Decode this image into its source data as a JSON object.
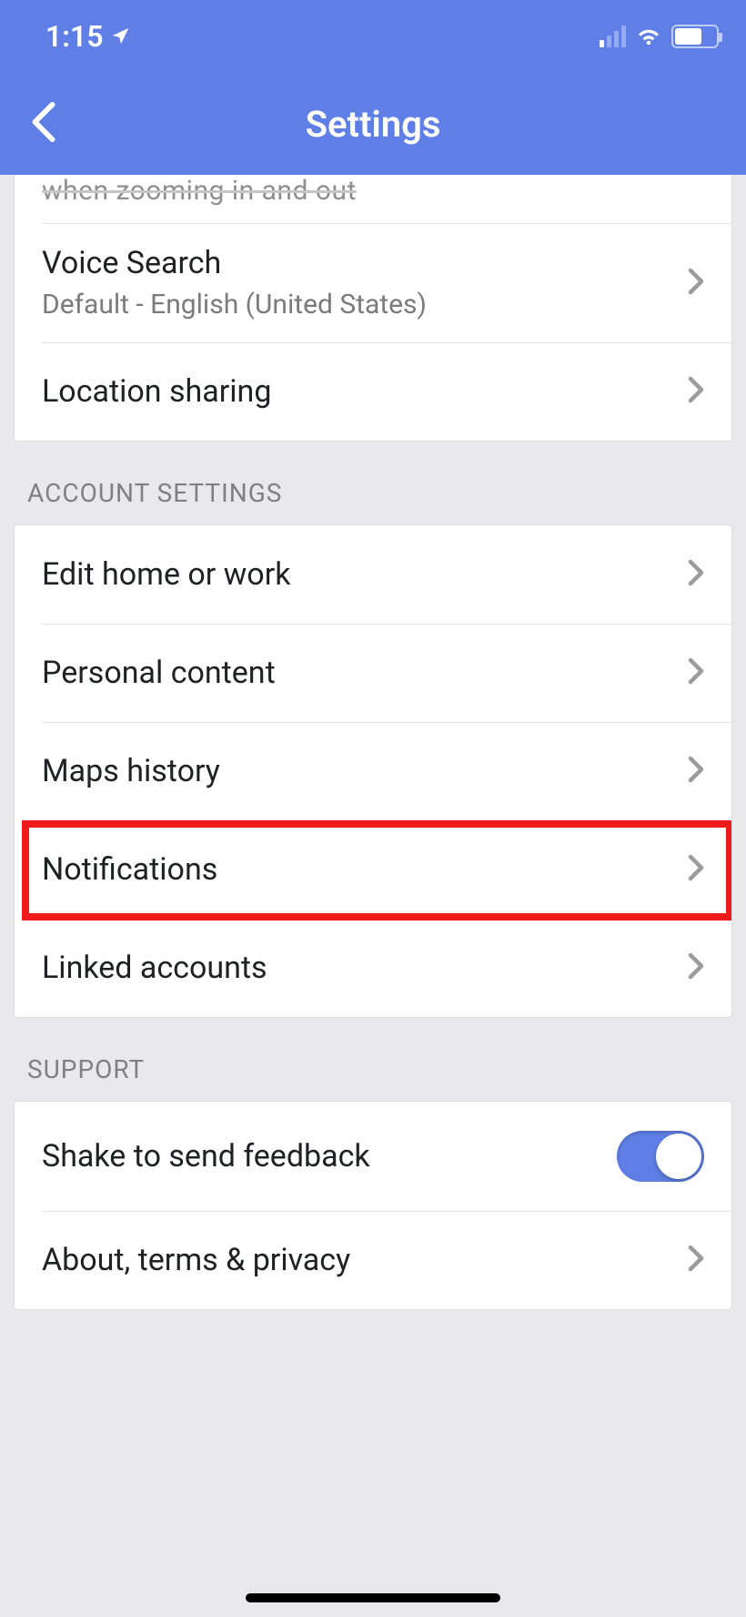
{
  "statusbar": {
    "time": "1:15"
  },
  "nav": {
    "title": "Settings"
  },
  "cutoff_row": {
    "subtitle_fragment": "when zooming in and out"
  },
  "section1": {
    "voice_search": {
      "title": "Voice Search",
      "subtitle": "Default - English (United States)"
    },
    "location_sharing": {
      "title": "Location sharing"
    }
  },
  "account_settings": {
    "header": "ACCOUNT SETTINGS",
    "items": {
      "edit_home_work": "Edit home or work",
      "personal_content": "Personal content",
      "maps_history": "Maps history",
      "notifications": "Notifications",
      "linked_accounts": "Linked accounts"
    }
  },
  "support": {
    "header": "SUPPORT",
    "items": {
      "shake_feedback": "Shake to send feedback",
      "about_terms_privacy": "About, terms & privacy"
    },
    "shake_feedback_enabled": true
  },
  "highlight": {
    "target": "notifications"
  }
}
